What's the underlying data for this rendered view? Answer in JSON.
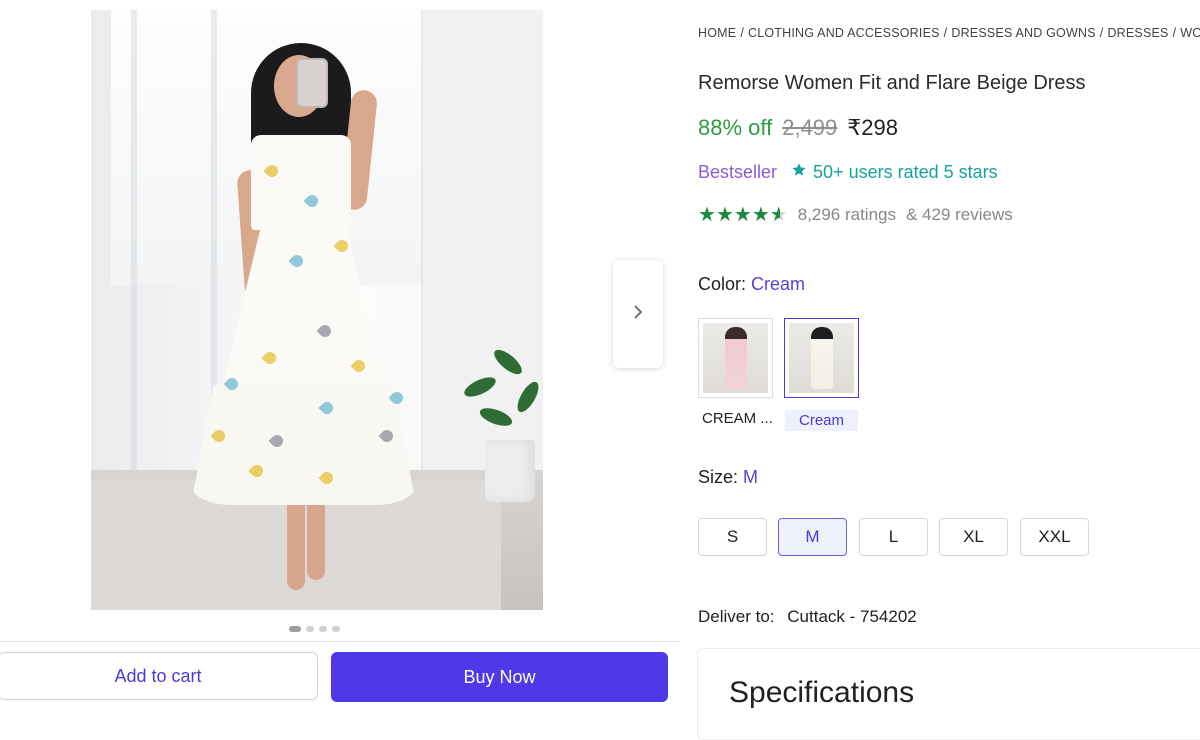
{
  "breadcrumb": {
    "items": [
      "HOME",
      "CLOTHING AND ACCESSORIES",
      "DRESSES AND GOWNS",
      "DRESSES",
      "WOMEN"
    ]
  },
  "product": {
    "title": "Remorse Women Fit and Flare Beige Dress",
    "discount": "88% off",
    "mrp": "2,499",
    "price": "₹298",
    "bestseller": "Bestseller",
    "rated_text": "50+ users rated 5 stars",
    "rating_value": 4.5,
    "ratings_count": "8,296 ratings",
    "reviews_count": "& 429 reviews"
  },
  "color": {
    "label": "Color:",
    "selected": "Cream",
    "options": [
      {
        "caption": "CREAM ...",
        "swatch_color": "#e7c3c8"
      },
      {
        "caption": "Cream",
        "swatch_color": "#f3efe4"
      }
    ]
  },
  "size": {
    "label": "Size:",
    "selected": "M",
    "options": [
      "S",
      "M",
      "L",
      "XL",
      "XXL"
    ]
  },
  "delivery": {
    "label": "Deliver to:",
    "location": "Cuttack - 754202"
  },
  "specifications": {
    "title": "Specifications"
  },
  "actions": {
    "add_to_cart": "Add to cart",
    "buy_now": "Buy Now"
  },
  "carousel": {
    "total": 4,
    "active": 1
  },
  "icons": {
    "next": "chevron-right-icon",
    "rated_star": "star-badge-icon"
  },
  "colors": {
    "accent": "#4f38e8",
    "discount_green": "#2e9c3f",
    "rating_green": "#1b8a3a",
    "bestseller_purple": "#8a5bd6",
    "rated_teal": "#15a39b"
  }
}
